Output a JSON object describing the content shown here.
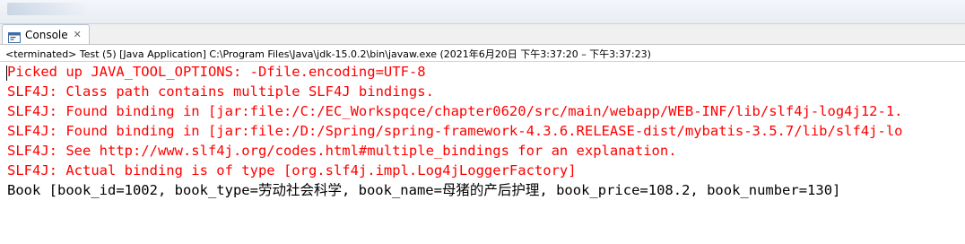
{
  "console_tab": {
    "label": "Console",
    "close_symbol": "✕",
    "icon": "console-icon"
  },
  "status": {
    "text": "<terminated> Test (5) [Java Application] C:\\Program Files\\Java\\jdk-15.0.2\\bin\\javaw.exe  (2021年6月20日 下午3:37:20 – 下午3:37:23)"
  },
  "output": {
    "lines": [
      {
        "text": "Picked up JAVA_TOOL_OPTIONS: -Dfile.encoding=UTF-8",
        "stream": "stderr"
      },
      {
        "text": "SLF4J: Class path contains multiple SLF4J bindings.",
        "stream": "stderr"
      },
      {
        "text": "SLF4J: Found binding in [jar:file:/C:/EC_Workspqce/chapter0620/src/main/webapp/WEB-INF/lib/slf4j-log4j12-1.",
        "stream": "stderr"
      },
      {
        "text": "SLF4J: Found binding in [jar:file:/D:/Spring/spring-framework-4.3.6.RELEASE-dist/mybatis-3.5.7/lib/slf4j-lo",
        "stream": "stderr"
      },
      {
        "text": "SLF4J: See http://www.slf4j.org/codes.html#multiple_bindings for an explanation.",
        "stream": "stderr"
      },
      {
        "text": "SLF4J: Actual binding is of type [org.slf4j.impl.Log4jLoggerFactory]",
        "stream": "stderr"
      },
      {
        "text": "Book [book_id=1002, book_type=劳动社会科学, book_name=母猪的产后护理, book_price=108.2, book_number=130]",
        "stream": "stdout"
      }
    ]
  },
  "colors": {
    "stderr": "#ff0000",
    "stdout": "#000000"
  }
}
